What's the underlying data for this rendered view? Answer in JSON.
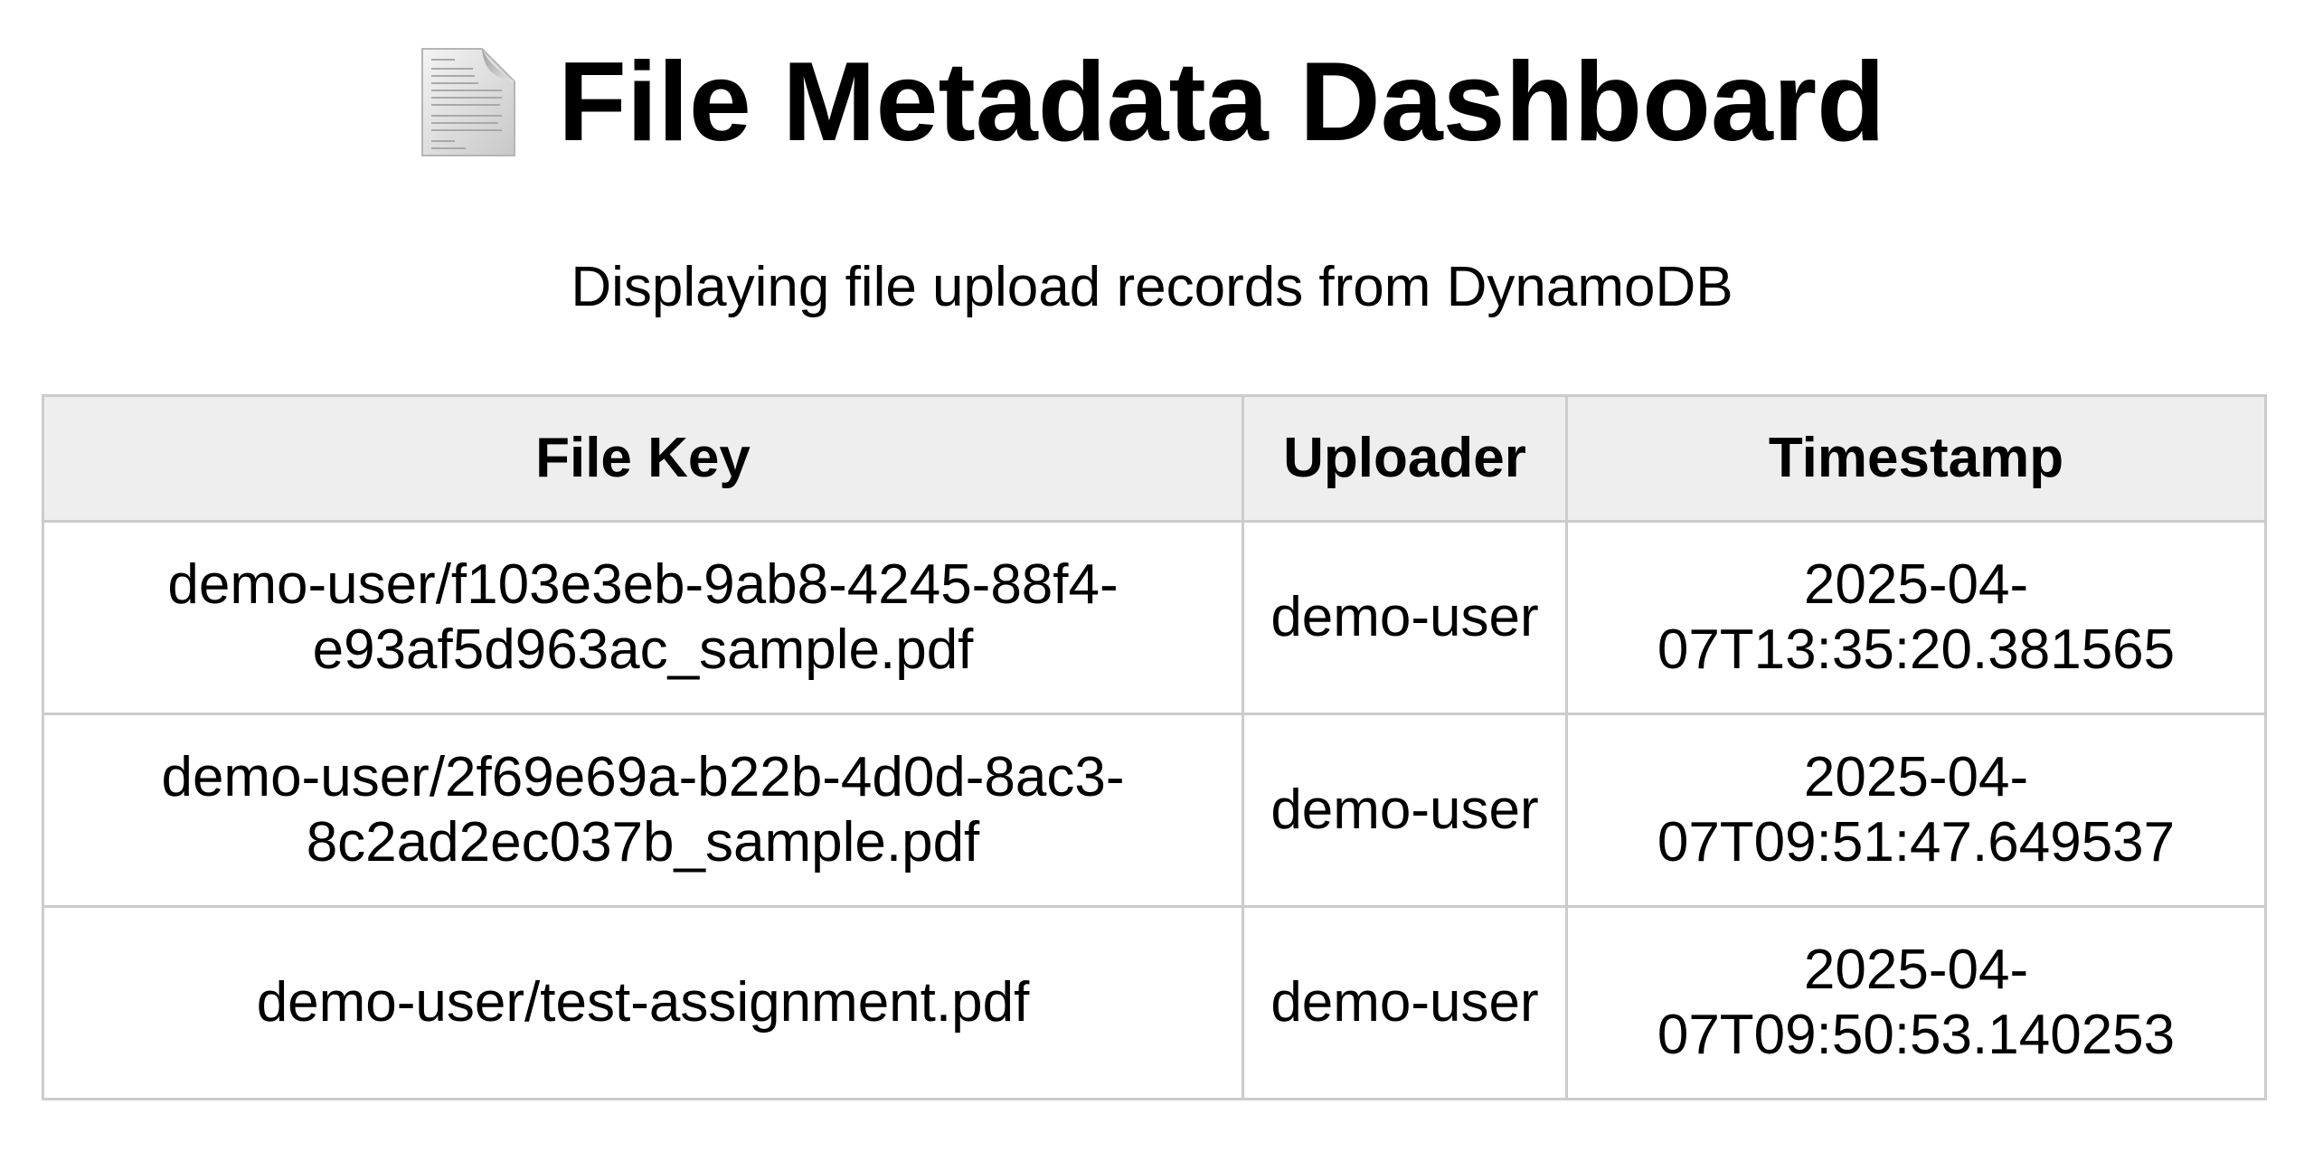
{
  "header": {
    "icon": "page-facing-up-icon",
    "title": "File Metadata Dashboard"
  },
  "subtitle": "Displaying file upload records from DynamoDB",
  "table": {
    "columns": [
      "File Key",
      "Uploader",
      "Timestamp"
    ],
    "rows": [
      {
        "file_key": "demo-user/f103e3eb-9ab8-4245-88f4-e93af5d963ac_sample.pdf",
        "uploader": "demo-user",
        "timestamp": "2025-04-07T13:35:20.381565"
      },
      {
        "file_key": "demo-user/2f69e69a-b22b-4d0d-8ac3-8c2ad2ec037b_sample.pdf",
        "uploader": "demo-user",
        "timestamp": "2025-04-07T09:51:47.649537"
      },
      {
        "file_key": "demo-user/test-assignment.pdf",
        "uploader": "demo-user",
        "timestamp": "2025-04-07T09:50:53.140253"
      }
    ]
  }
}
